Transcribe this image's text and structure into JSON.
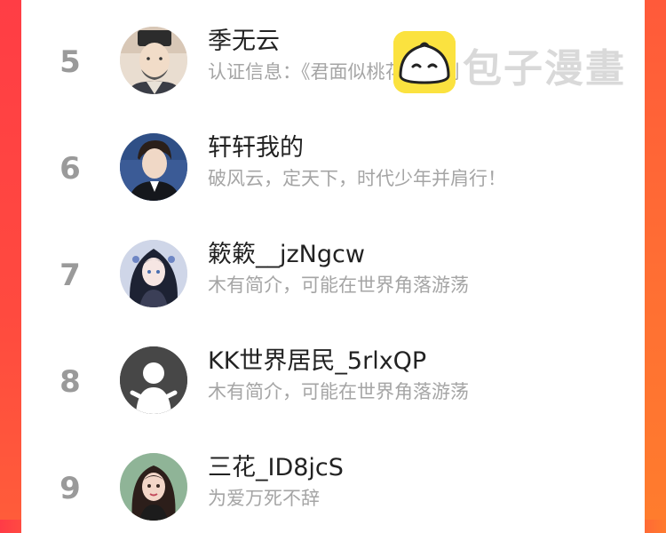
{
  "watermark": {
    "text": "包子漫畫"
  },
  "ranking": [
    {
      "rank": "5",
      "name": "季无云",
      "description": "认证信息：《君面似桃花》编剧",
      "avatar": "robed-elder-portrait"
    },
    {
      "rank": "6",
      "name": "轩轩我的",
      "description": "破风云，定天下，时代少年并肩行！",
      "avatar": "young-man-photo"
    },
    {
      "rank": "7",
      "name": "簌簌__jzNgcw",
      "description": "木有简介，可能在世界角落游荡",
      "avatar": "anime-girl-portrait"
    },
    {
      "rank": "8",
      "name": "KK世界居民_5rlxQP",
      "description": "木有简介，可能在世界角落游荡",
      "avatar": "default-user-icon"
    },
    {
      "rank": "9",
      "name": "三花_ID8jcS",
      "description": "为爱万死不辞",
      "avatar": "illustrated-girl-portrait"
    }
  ]
}
